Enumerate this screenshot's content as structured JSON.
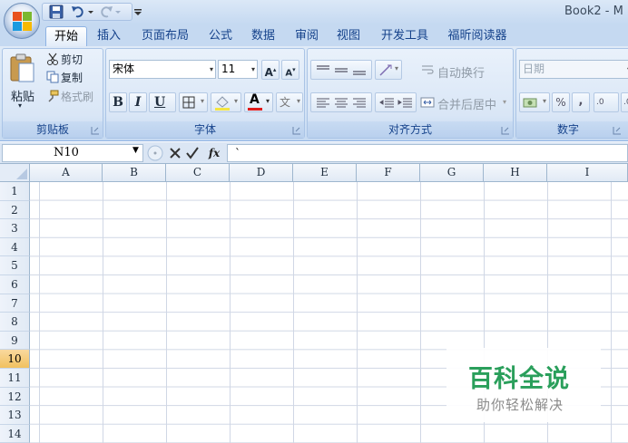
{
  "window": {
    "title": "Book2 - M"
  },
  "tabs": [
    {
      "label": "开始",
      "active": true
    },
    {
      "label": "插入"
    },
    {
      "label": "页面布局"
    },
    {
      "label": "公式"
    },
    {
      "label": "数据"
    },
    {
      "label": "审阅"
    },
    {
      "label": "视图"
    },
    {
      "label": "开发工具"
    },
    {
      "label": "福昕阅读器"
    }
  ],
  "ribbon": {
    "clipboard": {
      "label": "剪贴板",
      "paste": "粘贴",
      "cut": "剪切",
      "copy": "复制",
      "format_painter": "格式刷"
    },
    "font": {
      "label": "字体",
      "font_name": "宋体",
      "font_size": "11",
      "bold": "B",
      "italic": "I",
      "underline": "U",
      "font_color": "A",
      "font_color_value": "#e01b1b",
      "highlight_color_value": "#f4e542"
    },
    "alignment": {
      "label": "对齐方式",
      "wrap_text": "自动换行",
      "merge_center": "合并后居中"
    },
    "number": {
      "label": "数字",
      "format": "日期",
      "percent": "%",
      "comma": ",",
      "dec_increase": ".0 .00",
      "dec_decrease": ".00"
    }
  },
  "formula_bar": {
    "name_box": "N10",
    "fx": "fx",
    "value": "`"
  },
  "grid": {
    "columns": [
      "A",
      "B",
      "C",
      "D",
      "E",
      "F",
      "G",
      "H",
      "I"
    ],
    "rows": [
      "1",
      "2",
      "3",
      "4",
      "5",
      "6",
      "7",
      "8",
      "9",
      "10",
      "11",
      "12",
      "13",
      "14"
    ],
    "selected_row": "10"
  },
  "watermark": {
    "title": "百科全说",
    "subtitle": "助你轻松解决",
    "color": "#2a9f5b"
  }
}
